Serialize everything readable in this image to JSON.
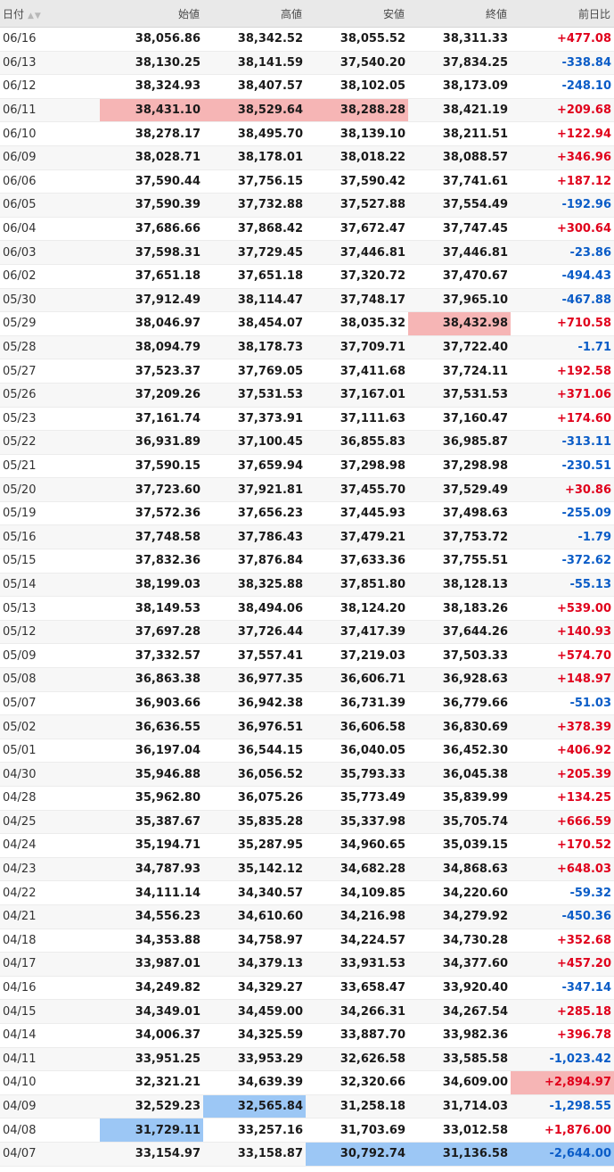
{
  "columns": {
    "date": "日付",
    "open": "始値",
    "high": "高値",
    "low": "安値",
    "close": "終値",
    "change": "前日比"
  },
  "colors": {
    "up": "#e0001b",
    "down": "#0a5cc7",
    "highlight_red": "#f6b5b5",
    "highlight_blue": "#9cc7f5"
  },
  "rows": [
    {
      "date": "06/16",
      "open": "38,056.86",
      "high": "38,342.52",
      "low": "38,055.52",
      "close": "38,311.33",
      "change": "+477.08"
    },
    {
      "date": "06/13",
      "open": "38,130.25",
      "high": "38,141.59",
      "low": "37,540.20",
      "close": "37,834.25",
      "change": "-338.84"
    },
    {
      "date": "06/12",
      "open": "38,324.93",
      "high": "38,407.57",
      "low": "38,102.05",
      "close": "38,173.09",
      "change": "-248.10"
    },
    {
      "date": "06/11",
      "open": "38,431.10",
      "high": "38,529.64",
      "low": "38,288.28",
      "close": "38,421.19",
      "change": "+209.68",
      "hl": {
        "open": "red",
        "high": "red",
        "low": "red"
      }
    },
    {
      "date": "06/10",
      "open": "38,278.17",
      "high": "38,495.70",
      "low": "38,139.10",
      "close": "38,211.51",
      "change": "+122.94"
    },
    {
      "date": "06/09",
      "open": "38,028.71",
      "high": "38,178.01",
      "low": "38,018.22",
      "close": "38,088.57",
      "change": "+346.96"
    },
    {
      "date": "06/06",
      "open": "37,590.44",
      "high": "37,756.15",
      "low": "37,590.42",
      "close": "37,741.61",
      "change": "+187.12"
    },
    {
      "date": "06/05",
      "open": "37,590.39",
      "high": "37,732.88",
      "low": "37,527.88",
      "close": "37,554.49",
      "change": "-192.96"
    },
    {
      "date": "06/04",
      "open": "37,686.66",
      "high": "37,868.42",
      "low": "37,672.47",
      "close": "37,747.45",
      "change": "+300.64"
    },
    {
      "date": "06/03",
      "open": "37,598.31",
      "high": "37,729.45",
      "low": "37,446.81",
      "close": "37,446.81",
      "change": "-23.86"
    },
    {
      "date": "06/02",
      "open": "37,651.18",
      "high": "37,651.18",
      "low": "37,320.72",
      "close": "37,470.67",
      "change": "-494.43"
    },
    {
      "date": "05/30",
      "open": "37,912.49",
      "high": "38,114.47",
      "low": "37,748.17",
      "close": "37,965.10",
      "change": "-467.88"
    },
    {
      "date": "05/29",
      "open": "38,046.97",
      "high": "38,454.07",
      "low": "38,035.32",
      "close": "38,432.98",
      "change": "+710.58",
      "hl": {
        "close": "red"
      }
    },
    {
      "date": "05/28",
      "open": "38,094.79",
      "high": "38,178.73",
      "low": "37,709.71",
      "close": "37,722.40",
      "change": "-1.71"
    },
    {
      "date": "05/27",
      "open": "37,523.37",
      "high": "37,769.05",
      "low": "37,411.68",
      "close": "37,724.11",
      "change": "+192.58"
    },
    {
      "date": "05/26",
      "open": "37,209.26",
      "high": "37,531.53",
      "low": "37,167.01",
      "close": "37,531.53",
      "change": "+371.06"
    },
    {
      "date": "05/23",
      "open": "37,161.74",
      "high": "37,373.91",
      "low": "37,111.63",
      "close": "37,160.47",
      "change": "+174.60"
    },
    {
      "date": "05/22",
      "open": "36,931.89",
      "high": "37,100.45",
      "low": "36,855.83",
      "close": "36,985.87",
      "change": "-313.11"
    },
    {
      "date": "05/21",
      "open": "37,590.15",
      "high": "37,659.94",
      "low": "37,298.98",
      "close": "37,298.98",
      "change": "-230.51"
    },
    {
      "date": "05/20",
      "open": "37,723.60",
      "high": "37,921.81",
      "low": "37,455.70",
      "close": "37,529.49",
      "change": "+30.86"
    },
    {
      "date": "05/19",
      "open": "37,572.36",
      "high": "37,656.23",
      "low": "37,445.93",
      "close": "37,498.63",
      "change": "-255.09"
    },
    {
      "date": "05/16",
      "open": "37,748.58",
      "high": "37,786.43",
      "low": "37,479.21",
      "close": "37,753.72",
      "change": "-1.79"
    },
    {
      "date": "05/15",
      "open": "37,832.36",
      "high": "37,876.84",
      "low": "37,633.36",
      "close": "37,755.51",
      "change": "-372.62"
    },
    {
      "date": "05/14",
      "open": "38,199.03",
      "high": "38,325.88",
      "low": "37,851.80",
      "close": "38,128.13",
      "change": "-55.13"
    },
    {
      "date": "05/13",
      "open": "38,149.53",
      "high": "38,494.06",
      "low": "38,124.20",
      "close": "38,183.26",
      "change": "+539.00"
    },
    {
      "date": "05/12",
      "open": "37,697.28",
      "high": "37,726.44",
      "low": "37,417.39",
      "close": "37,644.26",
      "change": "+140.93"
    },
    {
      "date": "05/09",
      "open": "37,332.57",
      "high": "37,557.41",
      "low": "37,219.03",
      "close": "37,503.33",
      "change": "+574.70"
    },
    {
      "date": "05/08",
      "open": "36,863.38",
      "high": "36,977.35",
      "low": "36,606.71",
      "close": "36,928.63",
      "change": "+148.97"
    },
    {
      "date": "05/07",
      "open": "36,903.66",
      "high": "36,942.38",
      "low": "36,731.39",
      "close": "36,779.66",
      "change": "-51.03"
    },
    {
      "date": "05/02",
      "open": "36,636.55",
      "high": "36,976.51",
      "low": "36,606.58",
      "close": "36,830.69",
      "change": "+378.39"
    },
    {
      "date": "05/01",
      "open": "36,197.04",
      "high": "36,544.15",
      "low": "36,040.05",
      "close": "36,452.30",
      "change": "+406.92"
    },
    {
      "date": "04/30",
      "open": "35,946.88",
      "high": "36,056.52",
      "low": "35,793.33",
      "close": "36,045.38",
      "change": "+205.39"
    },
    {
      "date": "04/28",
      "open": "35,962.80",
      "high": "36,075.26",
      "low": "35,773.49",
      "close": "35,839.99",
      "change": "+134.25"
    },
    {
      "date": "04/25",
      "open": "35,387.67",
      "high": "35,835.28",
      "low": "35,337.98",
      "close": "35,705.74",
      "change": "+666.59"
    },
    {
      "date": "04/24",
      "open": "35,194.71",
      "high": "35,287.95",
      "low": "34,960.65",
      "close": "35,039.15",
      "change": "+170.52"
    },
    {
      "date": "04/23",
      "open": "34,787.93",
      "high": "35,142.12",
      "low": "34,682.28",
      "close": "34,868.63",
      "change": "+648.03"
    },
    {
      "date": "04/22",
      "open": "34,111.14",
      "high": "34,340.57",
      "low": "34,109.85",
      "close": "34,220.60",
      "change": "-59.32"
    },
    {
      "date": "04/21",
      "open": "34,556.23",
      "high": "34,610.60",
      "low": "34,216.98",
      "close": "34,279.92",
      "change": "-450.36"
    },
    {
      "date": "04/18",
      "open": "34,353.88",
      "high": "34,758.97",
      "low": "34,224.57",
      "close": "34,730.28",
      "change": "+352.68"
    },
    {
      "date": "04/17",
      "open": "33,987.01",
      "high": "34,379.13",
      "low": "33,931.53",
      "close": "34,377.60",
      "change": "+457.20"
    },
    {
      "date": "04/16",
      "open": "34,249.82",
      "high": "34,329.27",
      "low": "33,658.47",
      "close": "33,920.40",
      "change": "-347.14"
    },
    {
      "date": "04/15",
      "open": "34,349.01",
      "high": "34,459.00",
      "low": "34,266.31",
      "close": "34,267.54",
      "change": "+285.18"
    },
    {
      "date": "04/14",
      "open": "34,006.37",
      "high": "34,325.59",
      "low": "33,887.70",
      "close": "33,982.36",
      "change": "+396.78"
    },
    {
      "date": "04/11",
      "open": "33,951.25",
      "high": "33,953.29",
      "low": "32,626.58",
      "close": "33,585.58",
      "change": "-1,023.42"
    },
    {
      "date": "04/10",
      "open": "32,321.21",
      "high": "34,639.39",
      "low": "32,320.66",
      "close": "34,609.00",
      "change": "+2,894.97",
      "hl": {
        "change": "red"
      }
    },
    {
      "date": "04/09",
      "open": "32,529.23",
      "high": "32,565.84",
      "low": "31,258.18",
      "close": "31,714.03",
      "change": "-1,298.55",
      "hl": {
        "high": "blue"
      }
    },
    {
      "date": "04/08",
      "open": "31,729.11",
      "high": "33,257.16",
      "low": "31,703.69",
      "close": "33,012.58",
      "change": "+1,876.00",
      "hl": {
        "open": "blue"
      }
    },
    {
      "date": "04/07",
      "open": "33,154.97",
      "high": "33,158.87",
      "low": "30,792.74",
      "close": "31,136.58",
      "change": "-2,644.00",
      "hl": {
        "low": "blue",
        "close": "blue",
        "change": "blue"
      }
    }
  ]
}
